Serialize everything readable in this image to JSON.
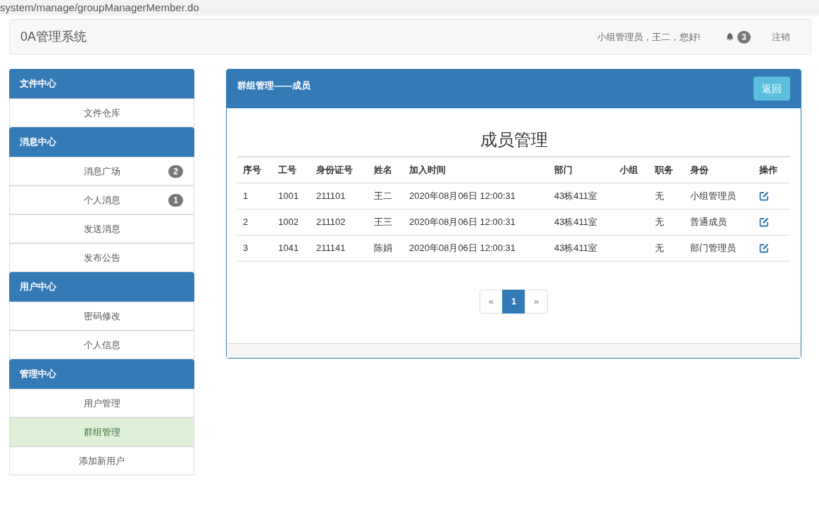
{
  "address_bar": {
    "url": "system/manage/groupManagerMember.do"
  },
  "navbar": {
    "brand": "0A管理系统",
    "greeting": "小组管理员，王二，您好!",
    "notification_count": "3",
    "logout": "注销"
  },
  "sidebar": {
    "sections": [
      {
        "title": "文件中心",
        "items": [
          {
            "label": "文件仓库",
            "selected": false
          }
        ]
      },
      {
        "title": "消息中心",
        "items": [
          {
            "label": "消息广场",
            "badge": "2",
            "selected": false
          },
          {
            "label": "个人消息",
            "badge": "1",
            "selected": false
          },
          {
            "label": "发送消息",
            "selected": false
          },
          {
            "label": "发布公告",
            "selected": false
          }
        ]
      },
      {
        "title": "用户中心",
        "items": [
          {
            "label": "密码修改",
            "selected": false
          },
          {
            "label": "个人信息",
            "selected": false
          }
        ]
      },
      {
        "title": "管理中心",
        "items": [
          {
            "label": "用户管理",
            "selected": false
          },
          {
            "label": "群组管理",
            "selected": true
          },
          {
            "label": "添加新用户",
            "selected": false
          }
        ]
      }
    ]
  },
  "panel": {
    "title": "群组管理——成员",
    "back_button": "返回",
    "heading": "成员管理",
    "table": {
      "columns": [
        "序号",
        "工号",
        "身份证号",
        "姓名",
        "加入时间",
        "部门",
        "小组",
        "职务",
        "身份",
        "操作"
      ],
      "rows": [
        [
          "1",
          "1001",
          "211101",
          "王二",
          "2020年08月06日 12:00:31",
          "43栋411室",
          "",
          "无",
          "小组管理员"
        ],
        [
          "2",
          "1002",
          "211102",
          "王三",
          "2020年08月06日 12:00:31",
          "43栋411室",
          "",
          "无",
          "普通成员"
        ],
        [
          "3",
          "1041",
          "211141",
          "陈娟",
          "2020年08月06日 12:00:31",
          "43栋411室",
          "",
          "无",
          "部门管理员"
        ]
      ]
    },
    "pagination": [
      {
        "label": "«",
        "selected": false
      },
      {
        "label": "1",
        "selected": true
      },
      {
        "label": "»",
        "selected": false
      }
    ]
  }
}
